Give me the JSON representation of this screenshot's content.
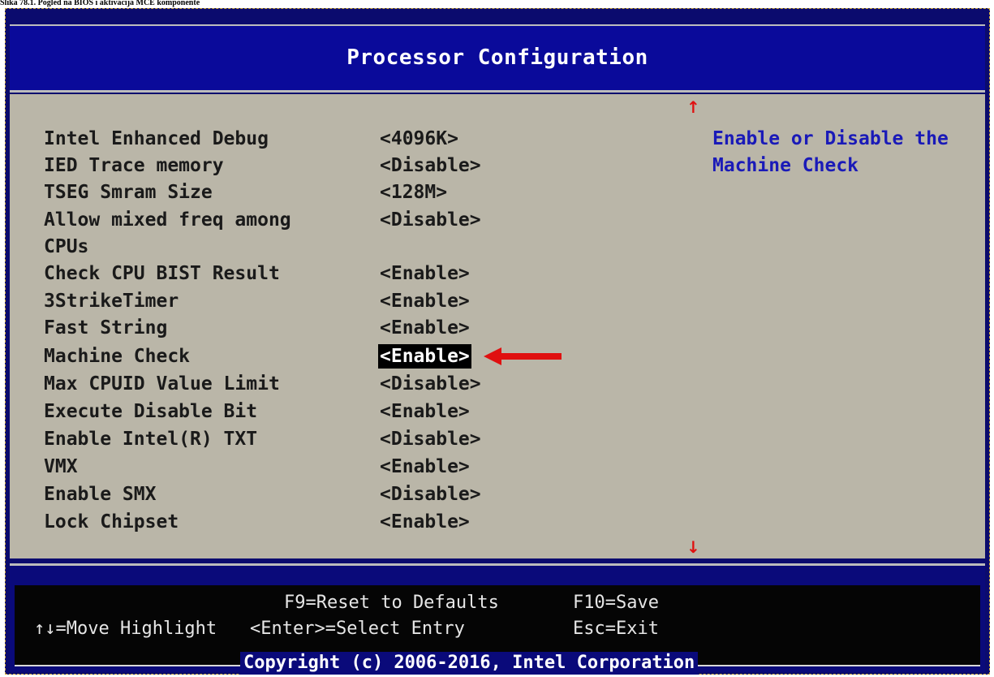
{
  "caption": "Slika 78.1. Pogled na BIOS i aktivacija MCE komponente",
  "title": "Processor Configuration",
  "settings": [
    {
      "label": "Intel Enhanced Debug",
      "value": "<4096K>"
    },
    {
      "label": "IED Trace memory",
      "value": "<Disable>"
    },
    {
      "label": "TSEG Smram Size",
      "value": "<128M>"
    },
    {
      "label": "Allow mixed freq among",
      "label2": "CPUs",
      "value": "<Disable>"
    },
    {
      "label": "Check CPU BIST Result",
      "value": "<Enable>"
    },
    {
      "label": "3StrikeTimer",
      "value": "<Enable>"
    },
    {
      "label": "Fast String",
      "value": "<Enable>"
    },
    {
      "label": "Machine Check",
      "value": "<Enable>",
      "selected": true
    },
    {
      "label": "Max CPUID Value Limit",
      "value": "<Disable>"
    },
    {
      "label": "Execute Disable Bit",
      "value": "<Enable>"
    },
    {
      "label": "Enable Intel(R) TXT",
      "value": "<Disable>"
    },
    {
      "label": "VMX",
      "value": "<Enable>"
    },
    {
      "label": "Enable SMX",
      "value": "<Disable>"
    },
    {
      "label": "Lock Chipset",
      "value": "<Enable>"
    }
  ],
  "help": {
    "line1": "Enable or Disable the",
    "line2": "Machine Check"
  },
  "footer": {
    "reset": "F9=Reset to Defaults",
    "save": "F10=Save",
    "move": "↑↓=Move Highlight",
    "select": "<Enter>=Select Entry",
    "exit": "Esc=Exit",
    "copyright": "Copyright (c) 2006-2016, Intel Corporation"
  },
  "colors": {
    "background": "#bab6a8",
    "header": "#0a0a9a",
    "help_text": "#1a1ab8",
    "pointer_arrow": "#e01010"
  },
  "icons": {
    "scroll_up": "arrow-up-icon",
    "scroll_down": "arrow-down-icon",
    "pointer": "arrow-left-icon"
  }
}
